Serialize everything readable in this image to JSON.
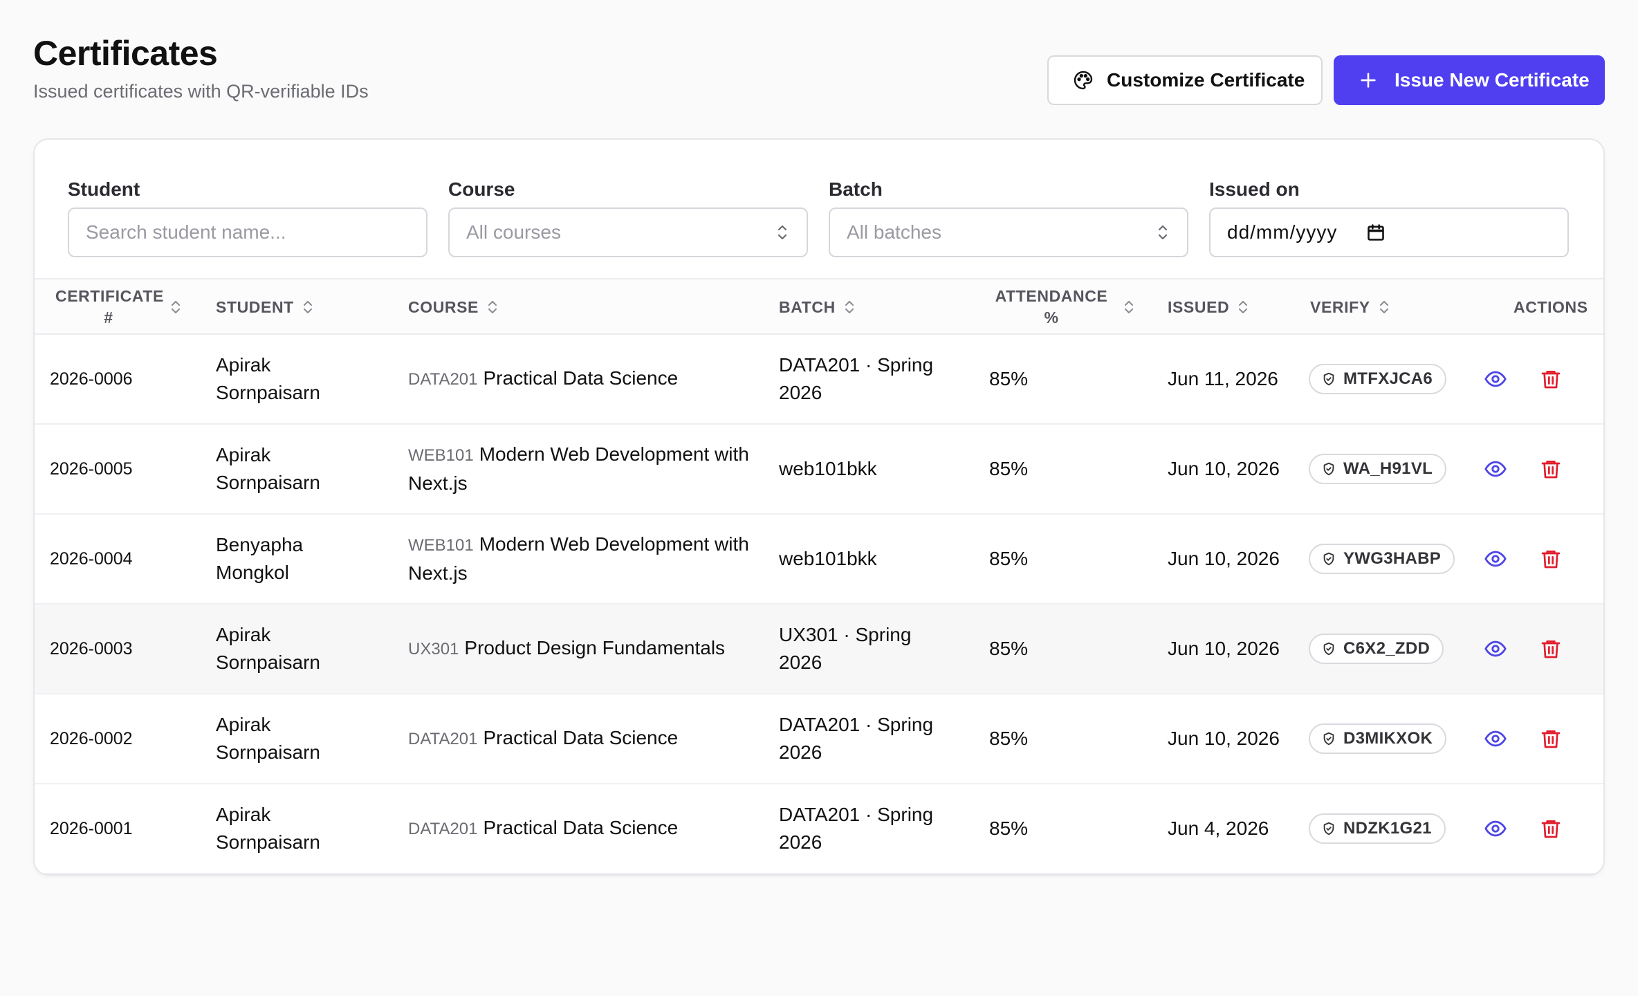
{
  "header": {
    "title": "Certificates",
    "subtitle": "Issued certificates with QR-verifiable IDs",
    "customize_label": "Customize Certificate",
    "issue_label": "Issue New Certificate"
  },
  "filters": {
    "student_label": "Student",
    "student_placeholder": "Search student name...",
    "course_label": "Course",
    "course_value": "All courses",
    "batch_label": "Batch",
    "batch_value": "All batches",
    "issued_label": "Issued on",
    "issued_value": "dd/mm/yyyy"
  },
  "table": {
    "columns": {
      "certificate": "CERTIFICATE #",
      "student": "STUDENT",
      "course": "COURSE",
      "batch": "BATCH",
      "attendance": "ATTENDANCE %",
      "issued": "ISSUED",
      "verify": "VERIFY",
      "actions": "ACTIONS"
    },
    "rows": [
      {
        "cert": "2026-0006",
        "student": "Apirak Sornpaisarn",
        "course_code": "DATA201",
        "course_name": "Practical Data Science",
        "batch": "DATA201 · Spring 2026",
        "attendance": "85%",
        "issued": "Jun 11, 2026",
        "verify": "MTFXJCA6"
      },
      {
        "cert": "2026-0005",
        "student": "Apirak Sornpaisarn",
        "course_code": "WEB101",
        "course_name": "Modern Web Development with Next.js",
        "batch": "web101bkk",
        "attendance": "85%",
        "issued": "Jun 10, 2026",
        "verify": "WA_H91VL"
      },
      {
        "cert": "2026-0004",
        "student": "Benyapha Mongkol",
        "course_code": "WEB101",
        "course_name": "Modern Web Development with Next.js",
        "batch": "web101bkk",
        "attendance": "85%",
        "issued": "Jun 10, 2026",
        "verify": "YWG3HABP"
      },
      {
        "cert": "2026-0003",
        "student": "Apirak Sornpaisarn",
        "course_code": "UX301",
        "course_name": "Product Design Fundamentals",
        "batch": "UX301 · Spring 2026",
        "attendance": "85%",
        "issued": "Jun 10, 2026",
        "verify": "C6X2_ZDD"
      },
      {
        "cert": "2026-0002",
        "student": "Apirak Sornpaisarn",
        "course_code": "DATA201",
        "course_name": "Practical Data Science",
        "batch": "DATA201 · Spring 2026",
        "attendance": "85%",
        "issued": "Jun 10, 2026",
        "verify": "D3MIKXOK"
      },
      {
        "cert": "2026-0001",
        "student": "Apirak Sornpaisarn",
        "course_code": "DATA201",
        "course_name": "Practical Data Science",
        "batch": "DATA201 · Spring 2026",
        "attendance": "85%",
        "issued": "Jun 4, 2026",
        "verify": "NDZK1G21"
      }
    ]
  },
  "colors": {
    "primary": "#4f3ff0",
    "view_icon": "#4f46e5",
    "delete_icon": "#e11d2e"
  },
  "icons": {
    "customize": "palette-icon",
    "issue": "plus-icon",
    "sort": "sort-icon",
    "select": "chevron-up-down-icon",
    "date": "calendar-icon",
    "verify": "shield-check-icon",
    "view": "eye-icon",
    "delete": "trash-icon"
  }
}
